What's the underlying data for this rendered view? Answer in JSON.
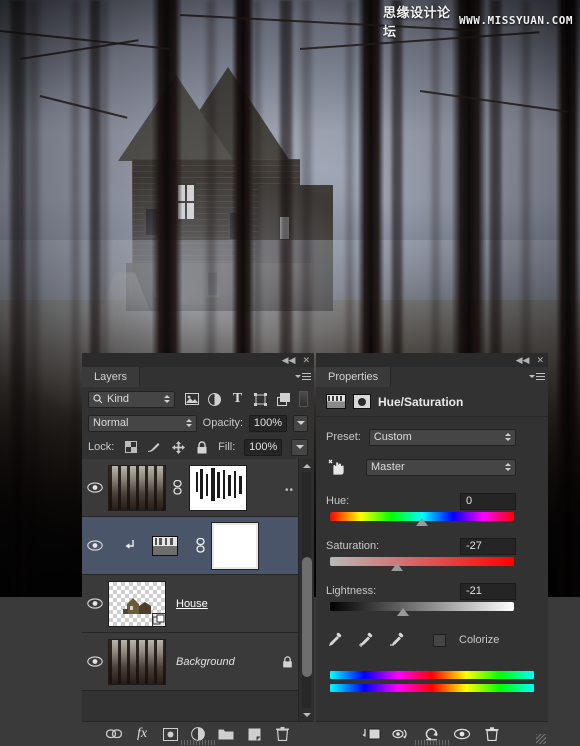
{
  "canvas": {
    "watermark_cn": "思缘设计论坛",
    "watermark_url": "WWW.MISSYUAN.COM"
  },
  "layers_panel": {
    "tab_label": "Layers",
    "collapse_icon": "◀◀",
    "close_icon": "✕",
    "filter": {
      "kind_label": "Kind",
      "search_icon": "search-icon",
      "icons": [
        "pixel-layer-icon",
        "adjustment-layer-icon",
        "type-layer-icon",
        "shape-layer-icon",
        "smart-object-icon"
      ],
      "toggle_icon": "filter-toggle-icon"
    },
    "blend_mode": "Normal",
    "opacity_label": "Opacity:",
    "opacity_value": "100%",
    "lock_label": "Lock:",
    "lock_icons": [
      "lock-transparency-icon",
      "lock-image-icon",
      "lock-position-icon",
      "lock-all-icon"
    ],
    "fill_label": "Fill:",
    "fill_value": "100%",
    "rows": [
      {
        "name": "",
        "visible": true,
        "selected": false,
        "thumb": "forest",
        "mask": "painted",
        "linked": true,
        "locked": false,
        "overflow": "••"
      },
      {
        "name": "",
        "visible": true,
        "selected": true,
        "thumb": "adjustment",
        "mask": "white",
        "linked": true,
        "locked": false,
        "clipped": true
      },
      {
        "name": "House",
        "visible": true,
        "selected": false,
        "thumb": "checker-house",
        "mask": "none",
        "linked": false,
        "locked": false,
        "smart_object": true,
        "editing": true
      },
      {
        "name": "Background",
        "visible": true,
        "selected": false,
        "thumb": "forest",
        "mask": "none",
        "linked": false,
        "locked": true
      }
    ],
    "footer_icons": [
      "link-layers-icon",
      "layer-style-fx-icon",
      "add-mask-icon",
      "new-adjustment-icon",
      "new-group-icon",
      "new-layer-icon",
      "delete-layer-icon"
    ]
  },
  "properties_panel": {
    "tab_label": "Properties",
    "collapse_icon": "◀◀",
    "close_icon": "✕",
    "title": "Hue/Saturation",
    "preset_label": "Preset:",
    "preset_value": "Custom",
    "hand_icon": "on-image-adjust-icon",
    "channel_value": "Master",
    "hue_label": "Hue:",
    "hue_value": "0",
    "saturation_label": "Saturation:",
    "saturation_value": "-27",
    "lightness_label": "Lightness:",
    "lightness_value": "-21",
    "eyedropper_icons": [
      "eyedropper-icon",
      "eyedropper-add-icon",
      "eyedropper-subtract-icon"
    ],
    "colorize_label": "Colorize",
    "colorize_checked": false,
    "footer_icons": [
      "clip-to-layer-icon",
      "view-previous-state-icon",
      "reset-icon",
      "toggle-visibility-icon",
      "delete-adjustment-icon"
    ]
  },
  "chart_data": null
}
